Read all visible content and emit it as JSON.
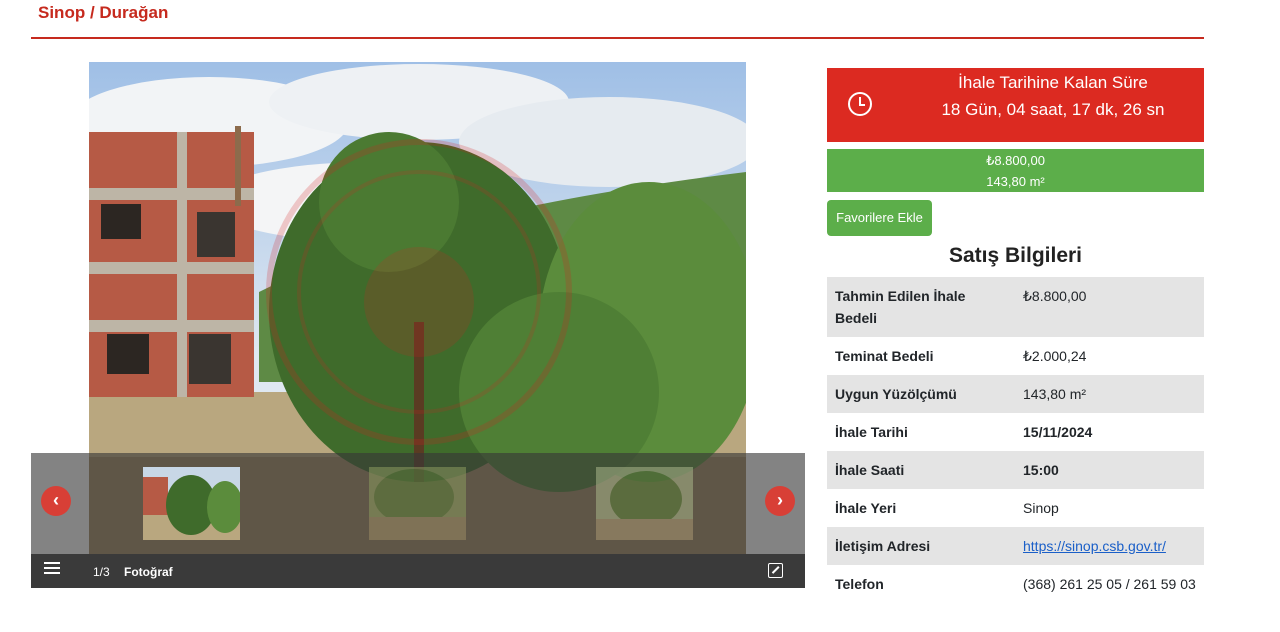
{
  "breadcrumb": "Sinop / Durağan",
  "countdown": {
    "title": "İhale Tarihine Kalan Süre",
    "value": "18 Gün, 04 saat, 17 dk, 26 sn",
    "icon": "clock-icon"
  },
  "price_box": {
    "price": "₺8.800,00",
    "area": "143,80 m²"
  },
  "favorite_button": "Favorilere Ekle",
  "sales_info": {
    "title": "Satış Bilgileri",
    "rows": [
      {
        "label": "Tahmin Edilen İhale Bedeli",
        "value": "₺8.800,00"
      },
      {
        "label": "Teminat Bedeli",
        "value": "₺2.000,24"
      },
      {
        "label": "Uygun Yüzölçümü",
        "value": "143,80 m²"
      },
      {
        "label": "İhale Tarihi",
        "value": "15/11/2024"
      },
      {
        "label": "İhale Saati",
        "value": "15:00"
      },
      {
        "label": "İhale Yeri",
        "value": "Sinop"
      },
      {
        "label": "İletişim Adresi",
        "value": "https://sinop.csb.gov.tr/"
      },
      {
        "label": "Telefon",
        "value": "(368) 261 25 05 / 261 59 03"
      }
    ]
  },
  "gallery": {
    "counter": "1/3",
    "label": "Fotoğraf",
    "prev_icon": "chevron-left-icon",
    "next_icon": "chevron-right-icon",
    "menu_icon": "list-icon",
    "fullscreen_icon": "fullscreen-icon",
    "prev_glyph": "‹",
    "next_glyph": "›"
  },
  "colors": {
    "brand_red": "#c62a1e",
    "timer_red": "#dc2a21",
    "green": "#5cae4a",
    "link": "#1a5fc8"
  }
}
